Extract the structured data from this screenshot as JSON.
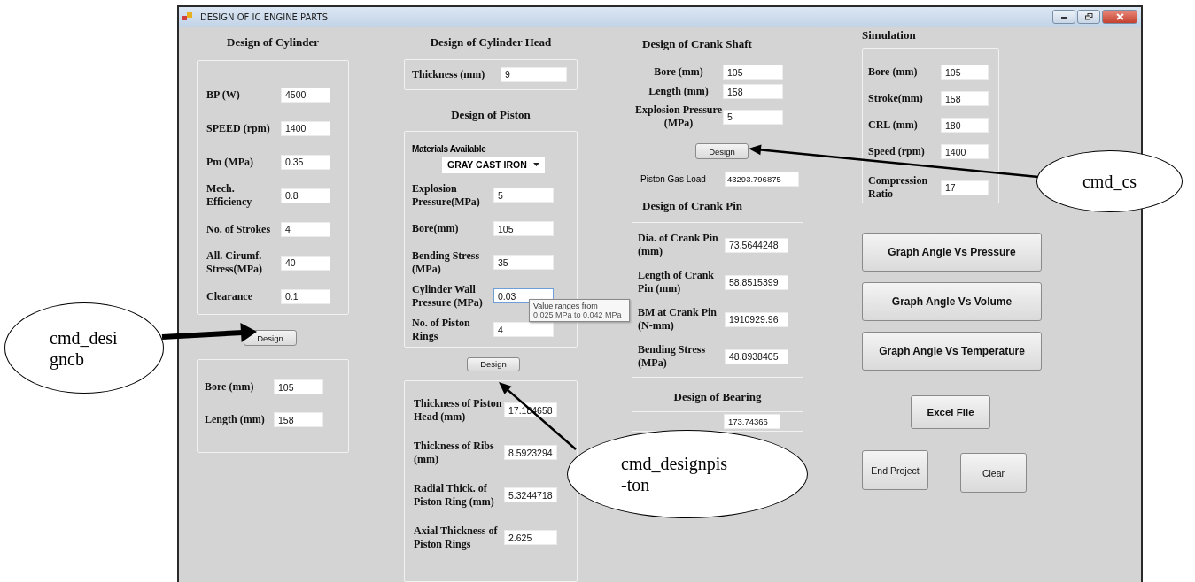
{
  "window": {
    "title": "DESIGN OF IC ENGINE PARTS"
  },
  "cylinder": {
    "heading": "Design of Cylinder",
    "inputs": [
      {
        "label": "BP (W)",
        "value": "4500"
      },
      {
        "label": "SPEED (rpm)",
        "value": "1400"
      },
      {
        "label": "Pm (MPa)",
        "value": "0.35"
      },
      {
        "label": "Mech. Efficiency",
        "value": "0.8"
      },
      {
        "label": "No. of Strokes",
        "value": "4"
      },
      {
        "label": "All. Cirumf. Stress(MPa)",
        "value": "40"
      },
      {
        "label": "Clearance",
        "value": "0.1"
      }
    ],
    "button": "Design",
    "outputs": [
      {
        "label": "Bore (mm)",
        "value": "105"
      },
      {
        "label": "Length (mm)",
        "value": "158"
      }
    ]
  },
  "cylinder_head": {
    "heading": "Design of Cylinder Head",
    "fields": [
      {
        "label": "Thickness (mm)",
        "value": "9"
      }
    ]
  },
  "piston": {
    "heading": "Design of Piston",
    "materials_label": "Materials Available",
    "material": "GRAY CAST IRON",
    "inputs": [
      {
        "label": "Explosion Pressure(MPa)",
        "value": "5",
        "focused": false
      },
      {
        "label": "Bore(mm)",
        "value": "105",
        "focused": false
      },
      {
        "label": "Bending Stress (MPa)",
        "value": "35",
        "focused": false
      },
      {
        "label": "Cylinder Wall Pressure (MPa)",
        "value": "0.03",
        "focused": true
      },
      {
        "label": "No. of Piston Rings",
        "value": "4",
        "focused": false
      }
    ],
    "tooltip": {
      "line_1": "Value ranges from",
      "line_2": "0.025 MPa to 0.042 MPa"
    },
    "button": "Design",
    "outputs": [
      {
        "label": "Thickness of Piston Head (mm)",
        "value": "17.184658"
      },
      {
        "label": "Thickness of Ribs (mm)",
        "value": "8.5923294"
      },
      {
        "label": "Radial Thick. of Piston Ring (mm)",
        "value": "5.3244718"
      },
      {
        "label": "Axial Thickness of Piston Rings",
        "value": "2.625"
      }
    ]
  },
  "crank_shaft": {
    "heading": "Design of Crank Shaft",
    "inputs": [
      {
        "label": "Bore (mm)",
        "value": "105"
      },
      {
        "label": "Length (mm)",
        "value": "158"
      },
      {
        "label": "Explosion Pressure (MPa)",
        "value": "5"
      }
    ],
    "button": "Design",
    "gas_load": {
      "label": "Piston Gas Load",
      "value": "43293.796875"
    }
  },
  "crank_pin": {
    "heading": "Design of Crank Pin",
    "outputs": [
      {
        "label": "Dia. of Crank Pin (mm)",
        "value": "73.5644248"
      },
      {
        "label": "Length of Crank Pin (mm)",
        "value": "58.8515399"
      },
      {
        "label": "BM at Crank Pin (N-mm)",
        "value": "1910929.96"
      },
      {
        "label": "Bending Stress (MPa)",
        "value": "48.8938405"
      }
    ]
  },
  "bearing": {
    "heading": "Design of Bearing",
    "value": "173.74366"
  },
  "simulation": {
    "heading": "Simulation",
    "inputs": [
      {
        "label": "Bore (mm)",
        "value": "105"
      },
      {
        "label": "Stroke(mm)",
        "value": "158"
      },
      {
        "label": "CRL (mm)",
        "value": "180"
      },
      {
        "label": "Speed (rpm)",
        "value": "1400"
      },
      {
        "label": "Compression Ratio",
        "value": "17"
      }
    ]
  },
  "actions": [
    {
      "label": "Graph Angle Vs Pressure",
      "kind": "graph"
    },
    {
      "label": "Graph Angle Vs Volume",
      "kind": "graph"
    },
    {
      "label": "Graph Angle Vs Temperature",
      "kind": "graph"
    },
    {
      "label": "Excel File",
      "kind": "excel"
    },
    {
      "label": "End Project",
      "kind": "small"
    },
    {
      "label": "Clear",
      "kind": "small"
    }
  ],
  "callouts": [
    {
      "lines": [
        "cmd_desi",
        "gncb"
      ]
    },
    {
      "lines": [
        "cmd_designpis",
        "-ton"
      ]
    },
    {
      "lines": [
        "cmd_cs"
      ]
    }
  ]
}
